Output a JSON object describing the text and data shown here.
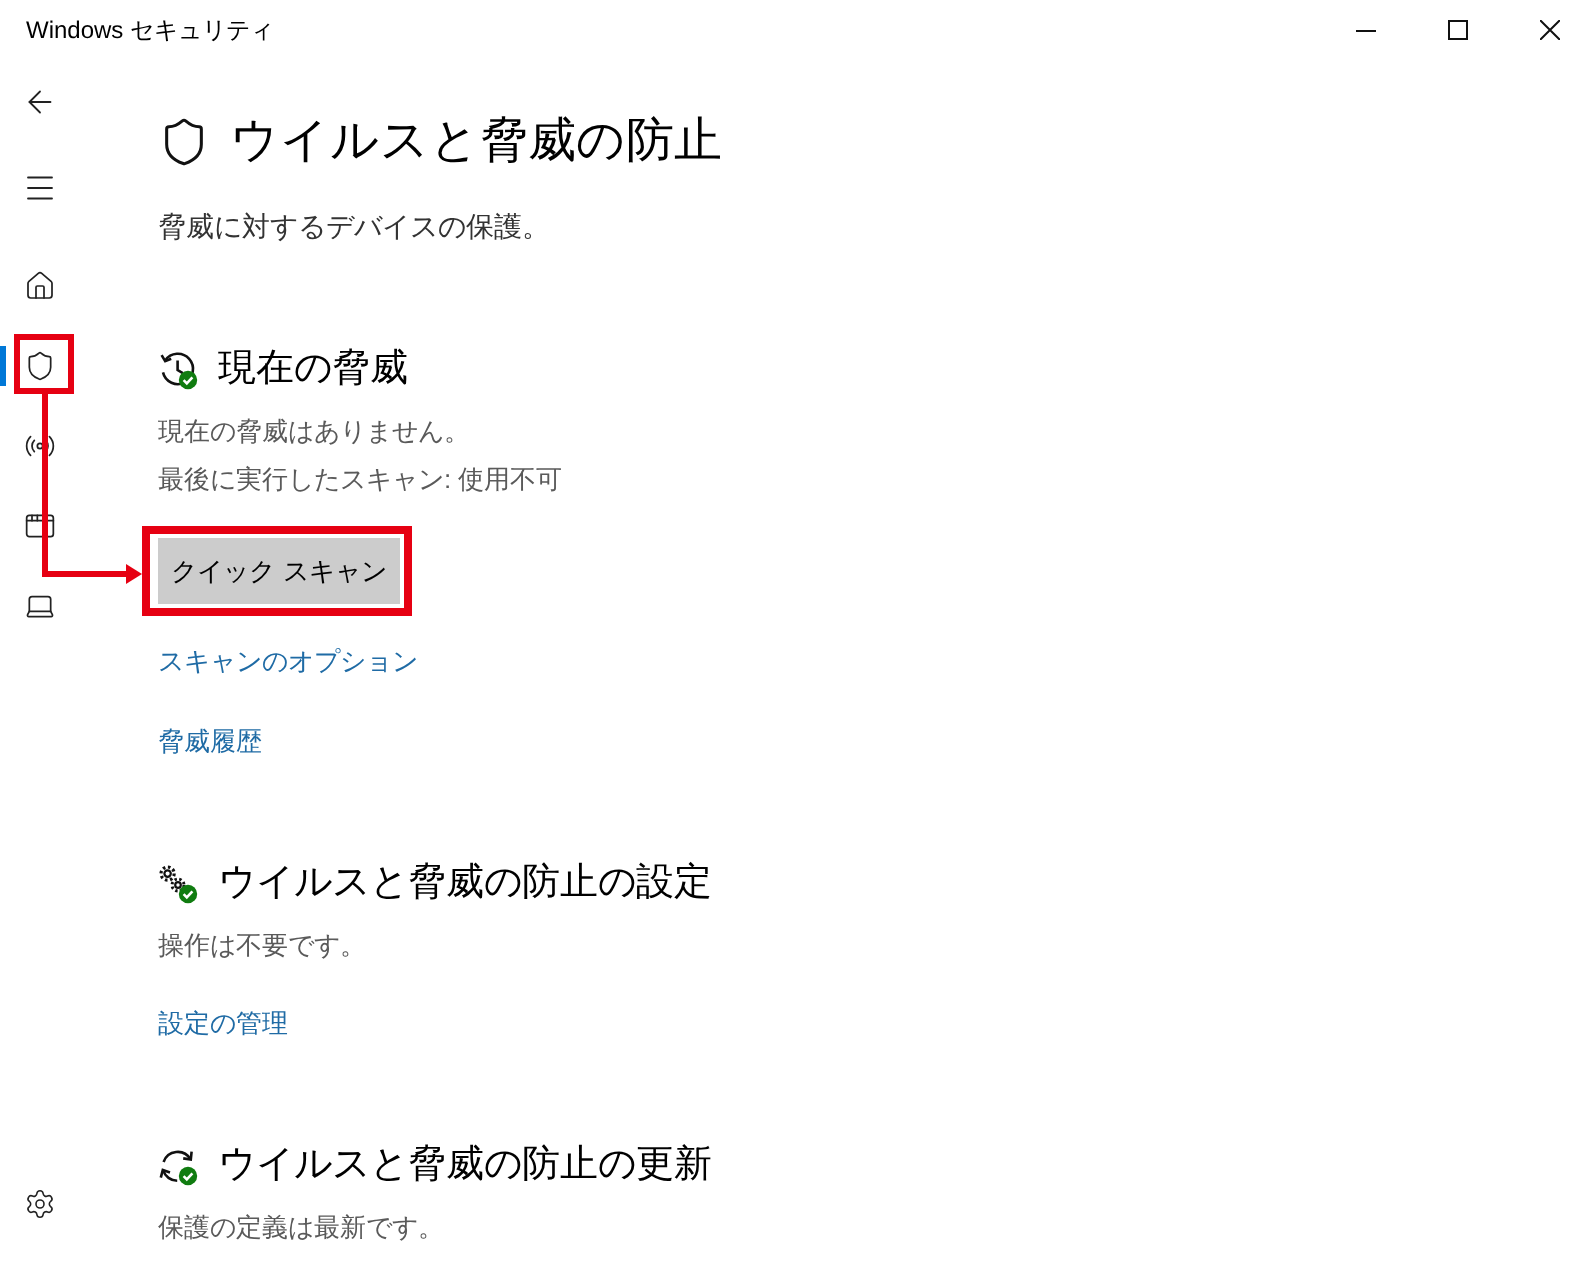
{
  "window": {
    "title": "Windows セキュリティ"
  },
  "nav": [
    {
      "kind": "home",
      "selected": false,
      "highlighted": false
    },
    {
      "kind": "shield",
      "selected": true,
      "highlighted": true
    },
    {
      "kind": "network",
      "selected": false,
      "highlighted": false
    },
    {
      "kind": "app",
      "selected": false,
      "highlighted": false
    },
    {
      "kind": "device",
      "selected": false,
      "highlighted": false
    }
  ],
  "page": {
    "title": "ウイルスと脅威の防止",
    "subtitle": "脅威に対するデバイスの保護。"
  },
  "sections": [
    {
      "kind": "threats",
      "heading": "現在の脅威",
      "lines": [
        "現在の脅威はありません。",
        "最後に実行したスキャン: 使用不可"
      ],
      "button": {
        "label": "クイック スキャン",
        "highlighted": true
      },
      "links": [
        "スキャンのオプション",
        "脅威履歴"
      ]
    },
    {
      "kind": "settings",
      "heading": "ウイルスと脅威の防止の設定",
      "lines": [
        "操作は不要です。"
      ],
      "links": [
        "設定の管理"
      ]
    },
    {
      "kind": "updates",
      "heading": "ウイルスと脅威の防止の更新",
      "lines": [
        "保護の定義は最新です。"
      ]
    }
  ]
}
